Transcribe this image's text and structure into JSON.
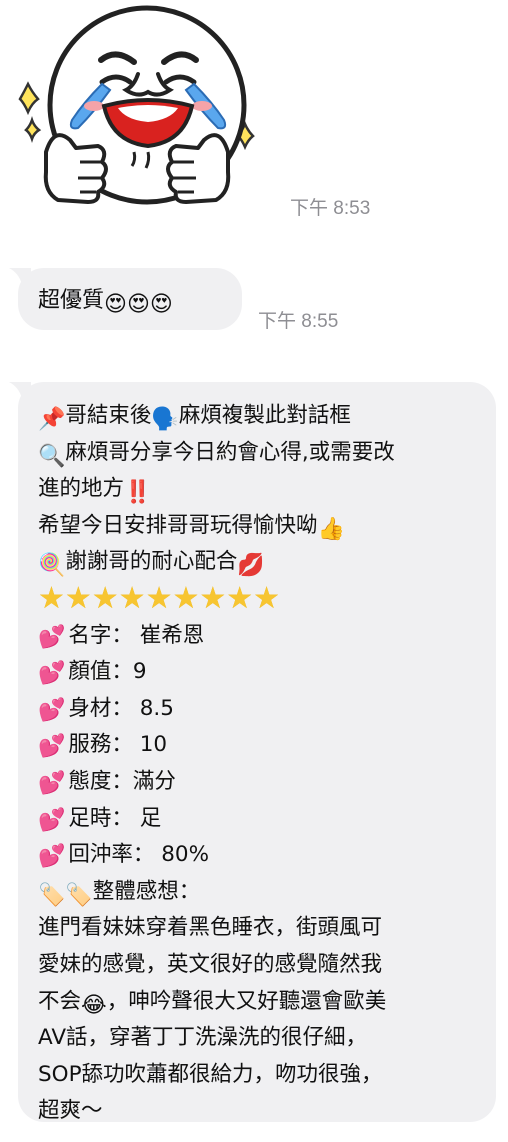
{
  "messages": {
    "sticker_time": "下午 8:53",
    "msg1": {
      "text": "超優質",
      "emojis": "😍😍😍",
      "time": "下午 8:55"
    },
    "msg2": {
      "l1_pin": "📌",
      "l1a": "哥結束後",
      "l1_speak": "🗣️",
      "l1b": "麻煩複製此對話框",
      "l2_mag": "🔍",
      "l2": "麻煩哥分享今日約會心得,或需要改",
      "l3": "進的地方",
      "l3_mark": "‼️",
      "l4": "希望今日安排哥哥玩得愉快呦",
      "l4_thumb": "👍",
      "l5_lolli": "🍭",
      "l5": "謝謝哥的耐心配合",
      "l5_kiss": "💋",
      "stars": "★★★★★★★★★",
      "heart": "💕",
      "r1": "名字： 崔希恩",
      "r2": "顏值：9",
      "r3": "身材： 8.5",
      "r4": "服務： 10",
      "r5": "態度：滿分",
      "r6": "足時： 足",
      "r7": "回沖率：  80%",
      "r8_icon": "🏷️🏷️",
      "r8": "整體感想：",
      "p1": "進門看妹妹穿着黑色睡衣，街頭風可",
      "p2": "愛妹的感覺，英文很好的感覺隨然我",
      "p3a": "不会",
      "p3_emo": "😂",
      "p3b": "，呻吟聲很大又好聽還會歐美",
      "p4": "AV話，穿著丁丁洗澡洗的很仔細，",
      "p5": "SOP舔功吹蕭都很給力，吻功很強，",
      "p6": "超爽～"
    }
  }
}
